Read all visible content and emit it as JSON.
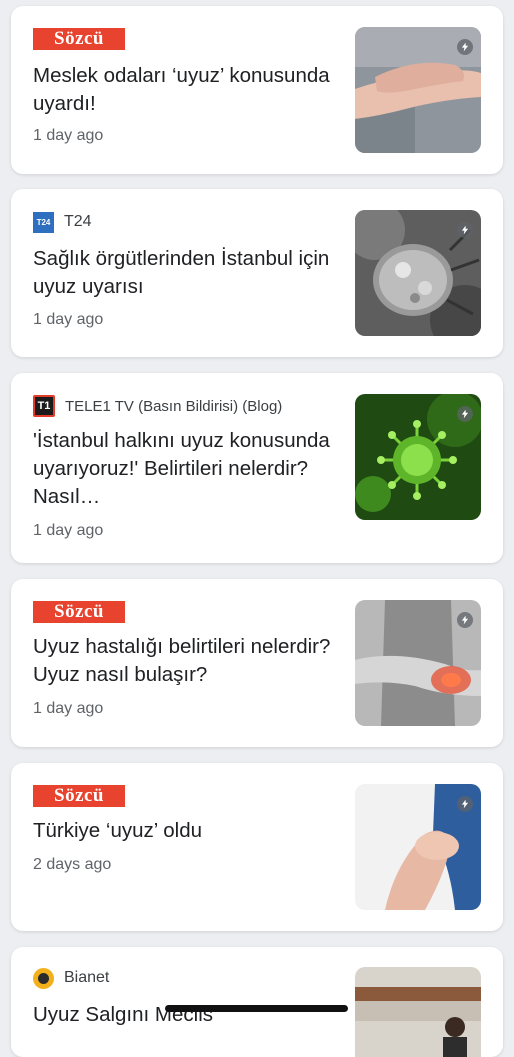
{
  "articles": [
    {
      "source": "Sözcü",
      "title": "Meslek odaları ‘uyuz’ konusunda uyardı!",
      "time": "1 day ago",
      "image": "skin-scratch"
    },
    {
      "source": "T24",
      "title": "Sağlık örgütlerinden İstanbul için uyuz uyarısı",
      "time": "1 day ago",
      "image": "mite-micrograph"
    },
    {
      "source": "TELE1 TV (Basın Bildirisi) (Blog)",
      "title": "'İstanbul halkını uyuz konusunda uyarıyoruz!' Belirtileri nelerdir? Nasıl…",
      "time": "1 day ago",
      "image": "green-virus"
    },
    {
      "source": "Sözcü",
      "title": "Uyuz hastalığı belirtileri nelerdir? Uyuz nasıl bulaşır?",
      "time": "1 day ago",
      "image": "itchy-arm"
    },
    {
      "source": "Sözcü",
      "title": "Türkiye ‘uyuz’ oldu",
      "time": "2 days ago",
      "image": "scratching-knee"
    },
    {
      "source": "Bianet",
      "title": "Uyuz Salgını Meclis",
      "time": "",
      "image": "parliament"
    }
  ],
  "logos": {
    "sozcu": "Sözcü",
    "t24": "T24",
    "tele1": "T1"
  },
  "colors": {
    "sozcu_red": "#e8432e",
    "t24_blue": "#2f6fbf",
    "bianet_yellow": "#f2b11a",
    "card": "#ffffff",
    "background": "#eceef1"
  },
  "icons": {
    "amp": "lightning-amp-icon"
  }
}
